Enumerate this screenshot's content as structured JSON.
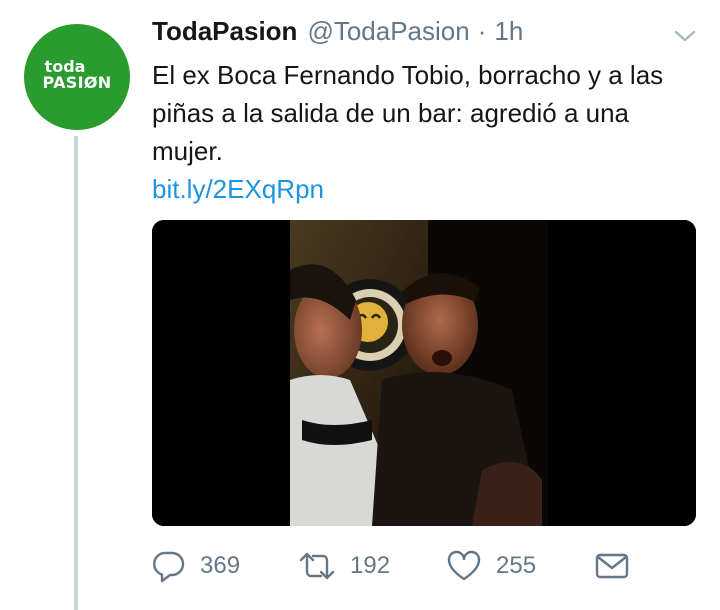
{
  "account": {
    "name": "TodaPasion",
    "handle": "@TodaPasion",
    "separator": "·",
    "time": "1h",
    "avatar_line1": "toda",
    "avatar_line2": "PASIØN"
  },
  "tweet": {
    "text": "El ex Boca Fernando Tobio, borracho y a las piñas a la salida de un bar: agredió a una mujer.",
    "link": "bit.ly/2EXqRpn"
  },
  "actions": {
    "replies": "369",
    "retweets": "192",
    "likes": "255"
  },
  "colors": {
    "avatar_bg": "#2a9b2f",
    "link": "#1b95e0",
    "muted": "#657786",
    "thread_line": "#ccd6dd"
  },
  "icons": [
    "reply-icon",
    "retweet-icon",
    "heart-icon",
    "direct-message-icon",
    "chevron-down-icon"
  ]
}
